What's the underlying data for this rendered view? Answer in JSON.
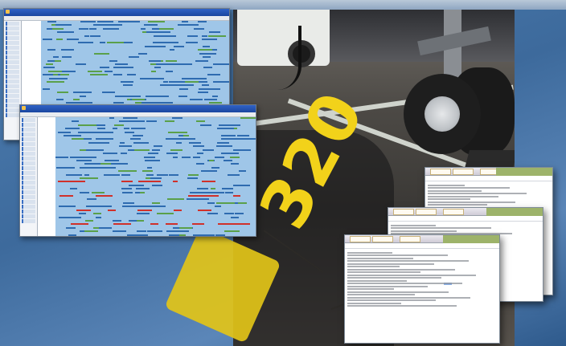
{
  "scene": {
    "colors": {
      "background": "#4f7fb2",
      "runway_paint": "#f2d21a",
      "window_title": "#2f62c6",
      "gantt_grid": "#9fc6e8",
      "gantt_bar": "#2e6bb0",
      "flight_green": "#5aa04a",
      "flight_red": "#d0302a",
      "report_header": "#9db36a"
    }
  },
  "photo": {
    "painted_marking": "320"
  },
  "schedule_window_back": {
    "icon_names": [
      "app-logo-icon"
    ]
  },
  "schedule_window_front": {
    "icon_names": [
      "app-logo-icon"
    ]
  },
  "reports": [
    {
      "tab_icons": [
        "report-tab-icon",
        "report-tab-icon",
        "report-tab-icon"
      ]
    },
    {
      "tab_icons": [
        "report-tab-icon",
        "report-tab-icon",
        "report-tab-icon"
      ]
    },
    {
      "tab_icons": [
        "report-tab-icon",
        "report-tab-icon",
        "report-tab-icon"
      ]
    }
  ]
}
